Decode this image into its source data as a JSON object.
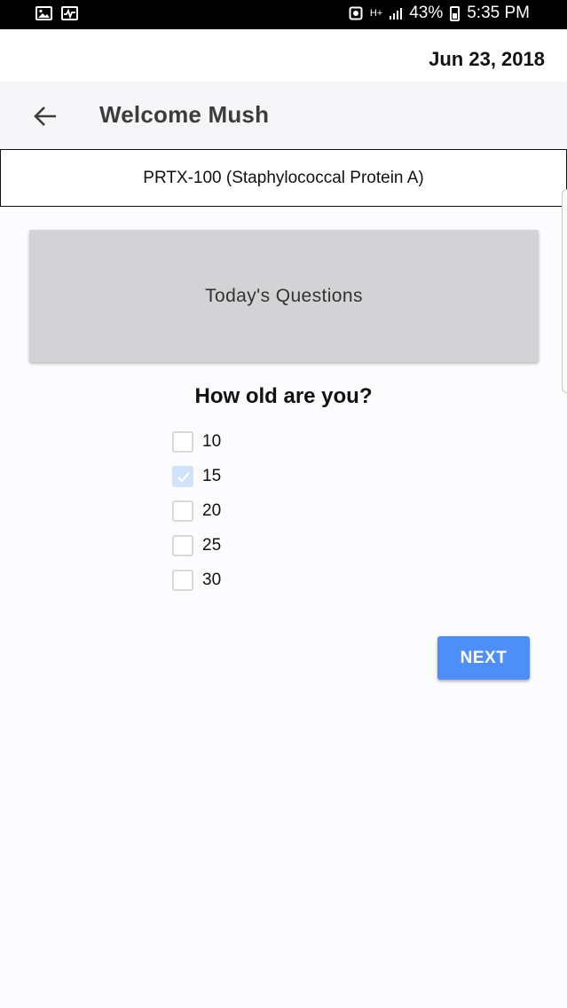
{
  "status_bar": {
    "battery_percent": "43%",
    "time": "5:35 PM",
    "network": "H+",
    "icons": [
      "image-icon",
      "activity-icon",
      "sim-icon",
      "network-icon",
      "signal-icon",
      "battery-icon"
    ]
  },
  "date": "Jun 23, 2018",
  "header": {
    "title": "Welcome Mush",
    "back_icon": "back-arrow-icon"
  },
  "drug_name": "PRTX-100 (Staphylococcal Protein A)",
  "questions_card": {
    "label": "Today's Questions"
  },
  "question": {
    "text": "How old are you?",
    "options": [
      {
        "label": "10",
        "checked": false
      },
      {
        "label": "15",
        "checked": true
      },
      {
        "label": "20",
        "checked": false
      },
      {
        "label": "25",
        "checked": false
      },
      {
        "label": "30",
        "checked": false
      }
    ]
  },
  "next_button": {
    "label": "NEXT"
  },
  "colors": {
    "accent": "#4d8ef9",
    "checked_box": "#cfe3fb",
    "card_bg": "#d3d2d5",
    "header_bg": "#f6f5f7"
  }
}
